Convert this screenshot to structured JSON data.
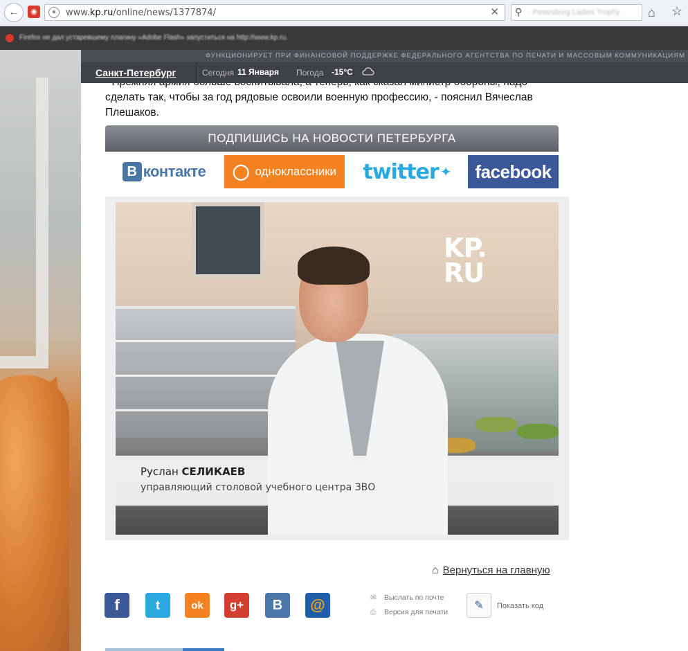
{
  "browser": {
    "url_prefix": "www.",
    "url_domain": "kp.ru",
    "url_path": "/online/news/1377874/",
    "search_placeholder": "- Petersburg Ladies Trophy"
  },
  "notice": {
    "text": "Firefox не дал устаревшему плагину «Adobe Flash» запуститься на http://www.kp.ru."
  },
  "site": {
    "funding": "ФУНКЦИОНИРУЕТ ПРИ ФИНАНСОВОЙ ПОДДЕРЖКЕ ФЕДЕРАЛЬНОГО АГЕНТСТВА ПО ПЕЧАТИ И МАССОВЫМ КОММУНИКАЦИЯМ",
    "city": "Санкт-Петербург",
    "today_label": "Сегодня",
    "today_value": "11 Января",
    "weather_label": "Погода",
    "weather_temp": "-15°C"
  },
  "article": {
    "line1": "- Прежняя армия больше воспитывала, а теперь, как сказал министр обороны, надо",
    "line2": "сделать так, чтобы за год рядовые освоили военную профессию, - пояснил Вячеслав",
    "line3": "Плешаков."
  },
  "subscribe": {
    "heading": "ПОДПИШИСЬ НА НОВОСТИ ПЕТЕРБУРГА",
    "vk_letter": "B",
    "vk_text": "контакте",
    "ok_text": "одноклассники",
    "twitter_text": "twitter",
    "facebook_text": "facebook"
  },
  "video": {
    "logo_line1": "KP.",
    "logo_line2": "RU",
    "first_name": "Руслан",
    "last_name": "СЕЛИКАЕВ",
    "role": "управляющий столовой учебного центра ЗВО"
  },
  "footer": {
    "back_link": "Вернуться на главную",
    "email_link": "Выслать по почте",
    "print_link": "Версия для печати",
    "code_label": "Показать код"
  },
  "share": {
    "fb": "f",
    "tw": "t",
    "ok": "ok",
    "gp": "g+",
    "vk": "B",
    "mail": "@"
  }
}
